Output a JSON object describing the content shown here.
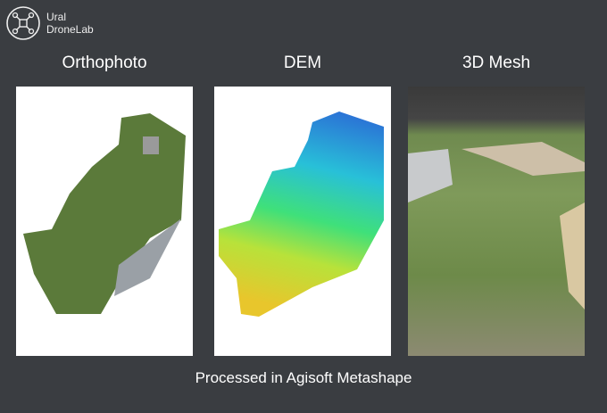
{
  "logo": {
    "line1": "Ural",
    "line2": "DroneLab"
  },
  "panels": [
    {
      "title": "Orthophoto"
    },
    {
      "title": "DEM"
    },
    {
      "title": "3D Mesh"
    }
  ],
  "caption": "Processed in Agisoft Metashape"
}
